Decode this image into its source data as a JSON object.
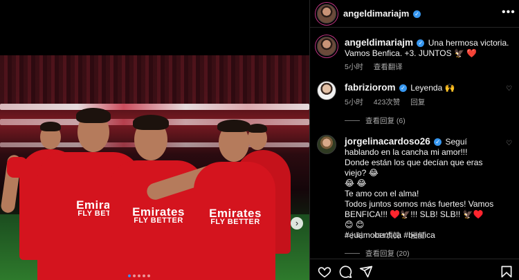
{
  "post": {
    "author": "angeldimariajm",
    "caption_author": "angeldimariajm",
    "caption_text_line1": "Una hermosa victoria.",
    "caption_text_line2": "Vamos Benfica. +3. JUNTOS 🦅 ❤️",
    "caption_time": "5小时",
    "caption_translate": "查看翻译"
  },
  "media": {
    "sponsor_main": "Emirates",
    "sponsor_sub": "FLY BETTER"
  },
  "comments": [
    {
      "author": "fabriziorom",
      "text": "Leyenda 🙌",
      "time": "5小时",
      "likes": "423次赞",
      "reply": "回复",
      "view_replies": "查看回复 (6)"
    },
    {
      "author": "jorgelinacardoso26",
      "line1": "Seguí",
      "line2": "hablando en la cancha mi amor!!!",
      "line3": "Donde están los que decían que eras viejo? 😂",
      "line4": "😂 😂",
      "line5": "Te amo con el alma!",
      "line6": "Todos juntos somos más fuertes! Vamos",
      "line7": "BENFICA!!! ♥️🦅!!! SLB! SLB!! 🦅♥️",
      "line8": "😊 😊",
      "line9": "#euamobenfica #benfica",
      "time": "4小时",
      "likes": "451次赞",
      "reply": "回复",
      "view_replies": "查看回复 (20)"
    }
  ],
  "icons": {
    "more": "more-options-icon",
    "verified": "verified-badge-icon",
    "heart": "heart-icon",
    "comment": "comment-icon",
    "share": "share-icon",
    "save": "bookmark-icon",
    "next": "chevron-right-icon"
  },
  "colors": {
    "background": "#000000",
    "verified": "#3797f0",
    "text_secondary": "#a8a8a8",
    "shirt_red": "#d4141e",
    "like_red": "#ff3040"
  }
}
